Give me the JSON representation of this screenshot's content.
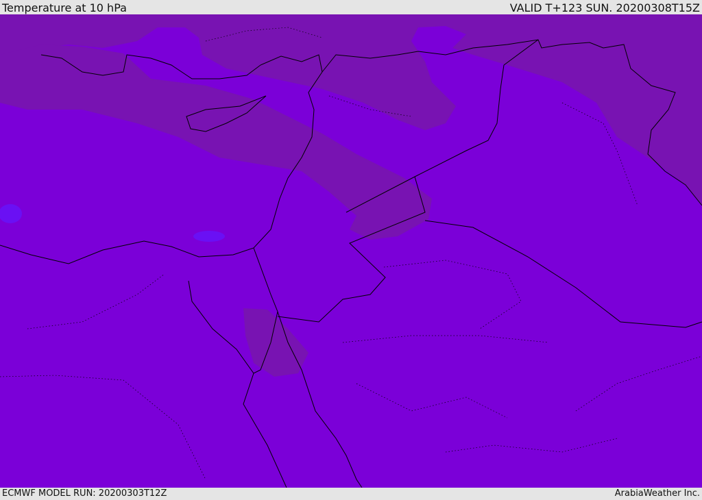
{
  "header": {
    "title": "Temperature at 10 hPa",
    "valid": "VALID T+123 SUN. 20200308T15Z"
  },
  "footer": {
    "model_run": "ECMWF MODEL RUN: 20200303T12Z",
    "credit": "ArabiaWeather Inc."
  },
  "colors": {
    "base_field": "#7b00d8",
    "warm_band": "#7813b2",
    "cold_pocket": "#6a10f4",
    "coastline": "#000000"
  }
}
